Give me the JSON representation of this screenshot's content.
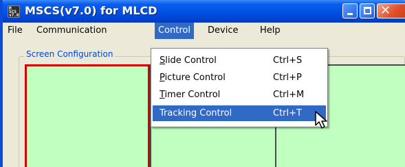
{
  "window": {
    "title": "MSCS(v7.0) for MLCD",
    "icon": "app-icon",
    "icon_text": [
      "M",
      "SCS",
      "v7.0"
    ],
    "controls": [
      "minimize",
      "maximize",
      "close"
    ]
  },
  "menubar": {
    "items": [
      {
        "label": "File"
      },
      {
        "label": "Communication"
      },
      {
        "label": "Control",
        "active": true
      },
      {
        "label": "Device"
      },
      {
        "label": "Help"
      }
    ]
  },
  "screen_config": {
    "label": "Screen Configuration"
  },
  "control_menu": {
    "items": [
      {
        "label": "Slide Control",
        "mnemonic": "S",
        "shortcut": "Ctrl+S"
      },
      {
        "label": "Picture Control",
        "mnemonic": "P",
        "shortcut": "Ctrl+P"
      },
      {
        "label": "Timer Control",
        "mnemonic": "T",
        "shortcut": "Ctrl+M"
      },
      {
        "label": "Tracking Control",
        "shortcut": "Ctrl+T",
        "highlighted": true
      }
    ]
  },
  "colors": {
    "title_bar": "#0452e2",
    "menu_highlight": "#316ac5",
    "screen_fill": "#c0ffc0",
    "selected_screen_border": "#d40000",
    "group_label": "#0046d5"
  }
}
